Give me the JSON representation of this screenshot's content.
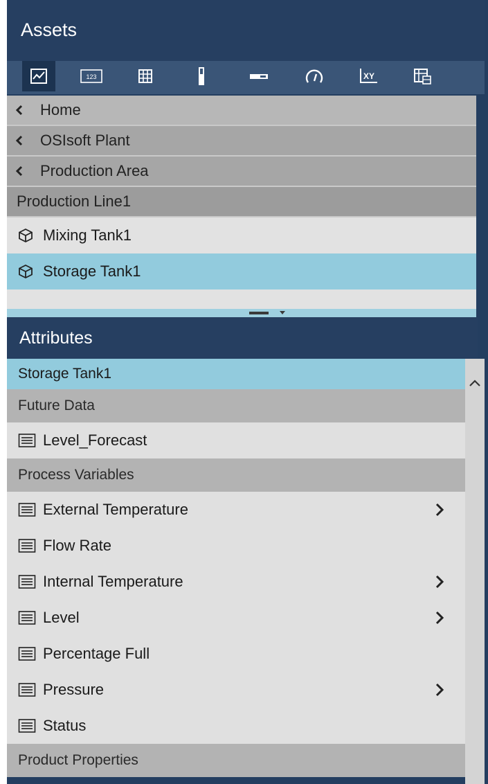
{
  "assets": {
    "title": "Assets",
    "toolbar": [
      {
        "name": "trend-icon",
        "active": true
      },
      {
        "name": "value-icon"
      },
      {
        "name": "table-icon"
      },
      {
        "name": "vertical-gauge-icon"
      },
      {
        "name": "horizontal-gauge-icon"
      },
      {
        "name": "radial-gauge-icon"
      },
      {
        "name": "xy-plot-icon"
      },
      {
        "name": "asset-comparison-table-icon"
      }
    ],
    "nav": {
      "home": "Home",
      "crumbs": [
        "OSIsoft Plant",
        "Production Area"
      ],
      "current": "Production Line1"
    },
    "items": [
      {
        "label": "Mixing Tank1",
        "selected": false
      },
      {
        "label": "Storage Tank1",
        "selected": true
      }
    ]
  },
  "attributes": {
    "title": "Attributes",
    "selected_element": "Storage Tank1",
    "categories": [
      {
        "label": "Future Data",
        "items": [
          {
            "label": "Level_Forecast",
            "expandable": false
          }
        ]
      },
      {
        "label": "Process Variables",
        "items": [
          {
            "label": "External Temperature",
            "expandable": true
          },
          {
            "label": "Flow Rate",
            "expandable": false
          },
          {
            "label": "Internal Temperature",
            "expandable": true
          },
          {
            "label": "Level",
            "expandable": true
          },
          {
            "label": "Percentage Full",
            "expandable": false
          },
          {
            "label": "Pressure",
            "expandable": true
          },
          {
            "label": "Status",
            "expandable": false
          }
        ]
      },
      {
        "label": "Product Properties",
        "items": []
      }
    ]
  },
  "colors": {
    "header": "#263f61",
    "toolbar": "#3a5577",
    "selected": "#92cbdd",
    "annotation_arrow": "#b5452e"
  }
}
